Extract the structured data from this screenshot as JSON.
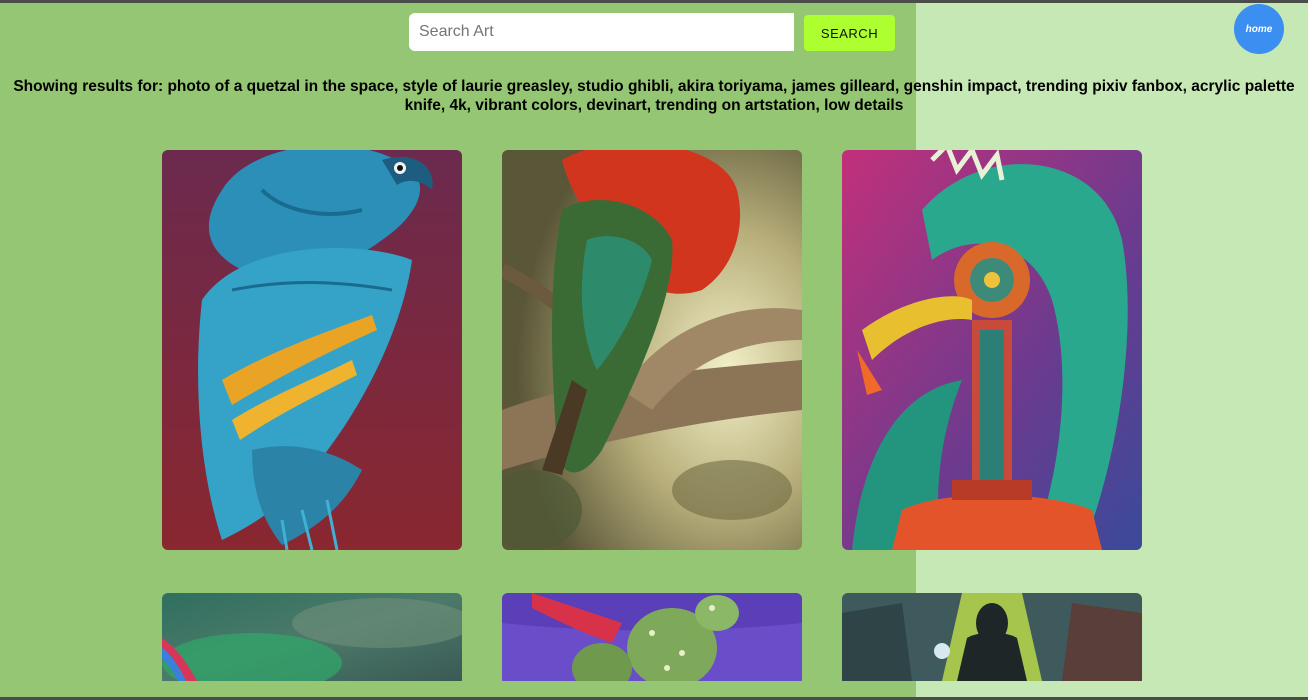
{
  "search": {
    "placeholder": "Search Art",
    "button_label": "SEARCH"
  },
  "home": {
    "label": "home"
  },
  "results": {
    "heading": "Showing results for: photo of a quetzal in the space, style of laurie greasley, studio ghibli, akira toriyama, james gilleard, genshin impact, trending pixiv fanbox, acrylic palette knife, 4k, vibrant colors, devinart, trending on artstation, low details"
  },
  "images": [
    {
      "subject": "blue-macaw-on-red-background"
    },
    {
      "subject": "red-green-parrot-on-branch"
    },
    {
      "subject": "teal-mechanical-quetzal-robot"
    },
    {
      "subject": "green-stormy-sky-painting"
    },
    {
      "subject": "cactus-creature-on-purple-sky"
    },
    {
      "subject": "hooded-figure-with-light-beam"
    }
  ],
  "colors": {
    "panel_green": "#95c673",
    "page_light_green": "#c6e8b4",
    "search_button": "#adff2f",
    "home_button": "#3a8ff0"
  }
}
